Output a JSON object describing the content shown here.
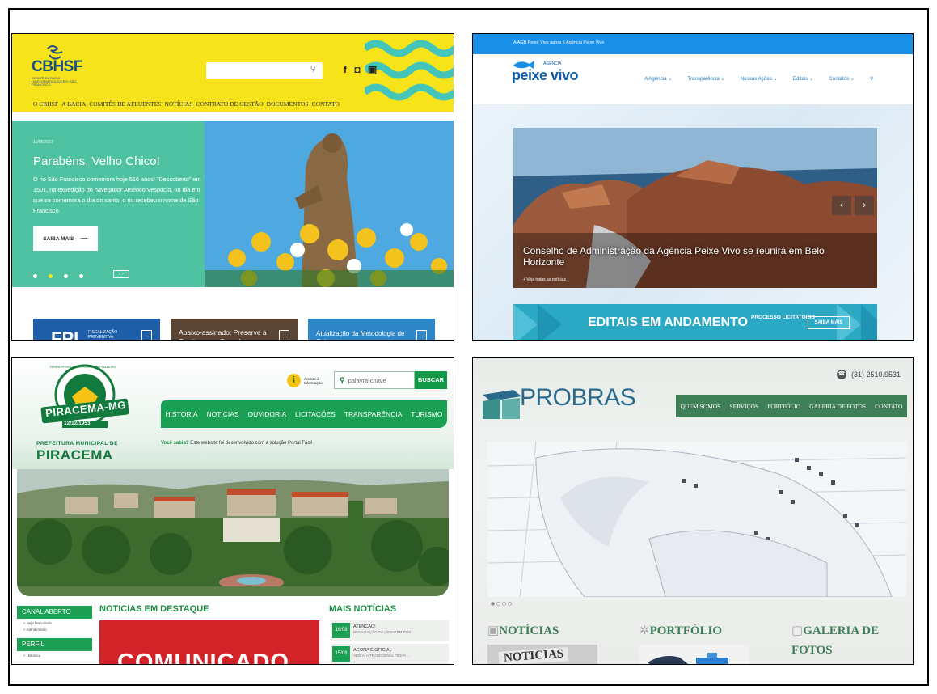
{
  "cbhsf": {
    "logo_text": "CBHSF",
    "logo_sub": "COMITÊ DA BACIA HIDROGRÁFICA DO RIO SÃO FRANCISCO",
    "search_icon": "search-icon",
    "social": "f ◘ ▣",
    "nav": [
      "O CBHSF",
      "A BACIA",
      "COMITÊS DE AFLUENTES",
      "NOTÍCIAS",
      "CONTRATO DE GESTÃO",
      "DOCUMENTOS",
      "CONTATO"
    ],
    "hero": {
      "date": "16/06/2017",
      "title": "Parabéns, Velho Chico!",
      "body": "O rio São Francisco comemora hoje 516 anos! \"Descoberto\" em 1501, na expedição do navegador Américo Vespúcio, no dia em que se comemora o dia do santo, o rio recebeu o nome de São Francisco.",
      "button": "SAIBA MAIS",
      "arrows": "‹ ›"
    },
    "cards": {
      "fpi": "FPI",
      "fpi_small": "FISCALIZAÇÃO PREVENTIVA INTEGRADA",
      "card2": "Abaixo-assinado: Preserve a Caatinga e o Cerrado",
      "card3": "Atualização da Metodologia de Cobrança",
      "arrow": "→"
    },
    "colors": {
      "yellow": "#f7e31a",
      "green": "#4fc2a1",
      "blue": "#1b4e86"
    }
  },
  "peixevivo": {
    "topbar": "A AGB Peixe Vivo agora é Agência Peixe Vivo",
    "logo_agencia": "AGÊNCIA",
    "logo": "peixe vivo",
    "nav": [
      "A Agência ⌄",
      "Transparência ⌄",
      "Nossas Ações ⌄",
      "Editais ⌄",
      "Contatos ⌄",
      "⚲"
    ],
    "slide_caption": "Conselho de Administração da Agência Peixe Vivo se reunirá em Belo Horizonte",
    "all_news": "+ Veja todas as notícias",
    "prev": "‹",
    "next": "›",
    "banner_main": "EDITAIS EM ANDAMENTO",
    "banner_sub": "PROCESSO LICITATÓRIO",
    "banner_btn": "SAIBA MAIS"
  },
  "piracema": {
    "emblem_top": "TERRA PRODUTIVA • POVO HOSPITALEIRO",
    "emblem_name": "PIRACEMA-MG",
    "emblem_date": "12/12/1953",
    "pref": "PREFEITURA MUNICIPAL DE",
    "city": "PIRACEMA",
    "access": "Acesso à Informação",
    "search_placeholder": "palavra-chave",
    "buscar": "BUSCAR",
    "nav": [
      "HISTÓRIA",
      "NOTÍCIAS",
      "OUVIDORIA",
      "LICITAÇÕES",
      "TRANSPARÊNCIA",
      "TURISMO"
    ],
    "sabia_b": "Você sabia?",
    "sabia": " Este website foi desenvolvido com a solução Portal Fácil",
    "left": {
      "canal": "CANAL ABERTO",
      "items": [
        "» Seja bem-vindo",
        "» Atendimento"
      ],
      "perfil": "PERFIL",
      "perfil_items": [
        "» Histórico"
      ]
    },
    "noticias_h": "NOTICIAS EM DESTAQUE",
    "comunicado": "COMUNICADO",
    "mais_h": "MAIS NOTÍCIAS",
    "mais": [
      {
        "date": "16/08",
        "title": "ATENÇÃO!",
        "sub": "DIVULGAÇÃO DA LISTAGEM DOS ..."
      },
      {
        "date": "15/08",
        "title": "AGORA É OFICIAL",
        "sub": "VEM AÍ A TRADICIONAL FESTA ..."
      }
    ]
  },
  "probras": {
    "phone": "(31) 2510.9531",
    "logo": "PROBRAS",
    "nav": [
      "QUEM SOMOS",
      "SERVIÇOS",
      "PORTFÓLIO",
      "GALERIA DE FOTOS",
      "CONTATO"
    ],
    "noticias": "NOTÍCIAS",
    "portfolio": "PORTFÓLIO",
    "galeria": "GALERIA DE FOTOS",
    "thumb_text": "NOTICIAS"
  }
}
